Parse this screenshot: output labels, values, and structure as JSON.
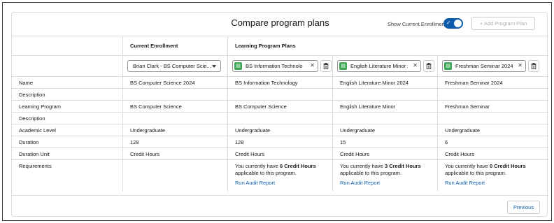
{
  "header": {
    "title": "Compare program plans",
    "toggle_label": "Show Current Enrollment",
    "toggle_state": "on",
    "add_button": "+ Add Program Plan"
  },
  "columns": {
    "current": "Current Enrollment",
    "plans": "Learning Program Plans"
  },
  "selectors": {
    "current_enrollment": "Brian Clark - BS Computer Scie...",
    "plans": [
      "BS Information Technolo",
      "English Literature Minor 2",
      "Freshman Seminar 2024"
    ]
  },
  "rows": [
    {
      "label": "Name",
      "values": [
        "BS Computer Science 2024",
        "BS Information Technology",
        "English Literature Minor 2024",
        "Freshman Seminar 2024"
      ]
    },
    {
      "label": "Description",
      "values": [
        "",
        "",
        "",
        ""
      ]
    },
    {
      "label": "Learning Program",
      "values": [
        "BS Computer Science",
        "BS Computer Science",
        "English Literature Minor",
        "Freshman Seminar"
      ]
    },
    {
      "label": "Description",
      "values": [
        "",
        "",
        "",
        ""
      ]
    },
    {
      "label": "Academic Level",
      "values": [
        "Undergraduate",
        "Undergraduate",
        "Undergraduate",
        "Undergraduate"
      ]
    },
    {
      "label": "Duration",
      "values": [
        "128",
        "128",
        "15",
        "6"
      ]
    },
    {
      "label": "Duration Unit",
      "values": [
        "Credit Hours",
        "Credit Hours",
        "Credit Hours",
        "Credit Hours"
      ]
    }
  ],
  "requirements": {
    "label": "Requirements",
    "prefix": "You currently have",
    "suffix": "applicable to this program.",
    "link": "Run Audit Report",
    "credits": [
      "6 Credit Hours",
      "3 Credit Hours",
      "0 Credit Hours"
    ]
  },
  "footer": {
    "previous": "Previous"
  },
  "colors": {
    "accent": "#0b5cab",
    "plan_icon": "#3ba755"
  },
  "icons": [
    "check-icon",
    "plus-icon",
    "chevron-down-icon",
    "program-plan-icon",
    "close-icon",
    "trash-icon"
  ]
}
